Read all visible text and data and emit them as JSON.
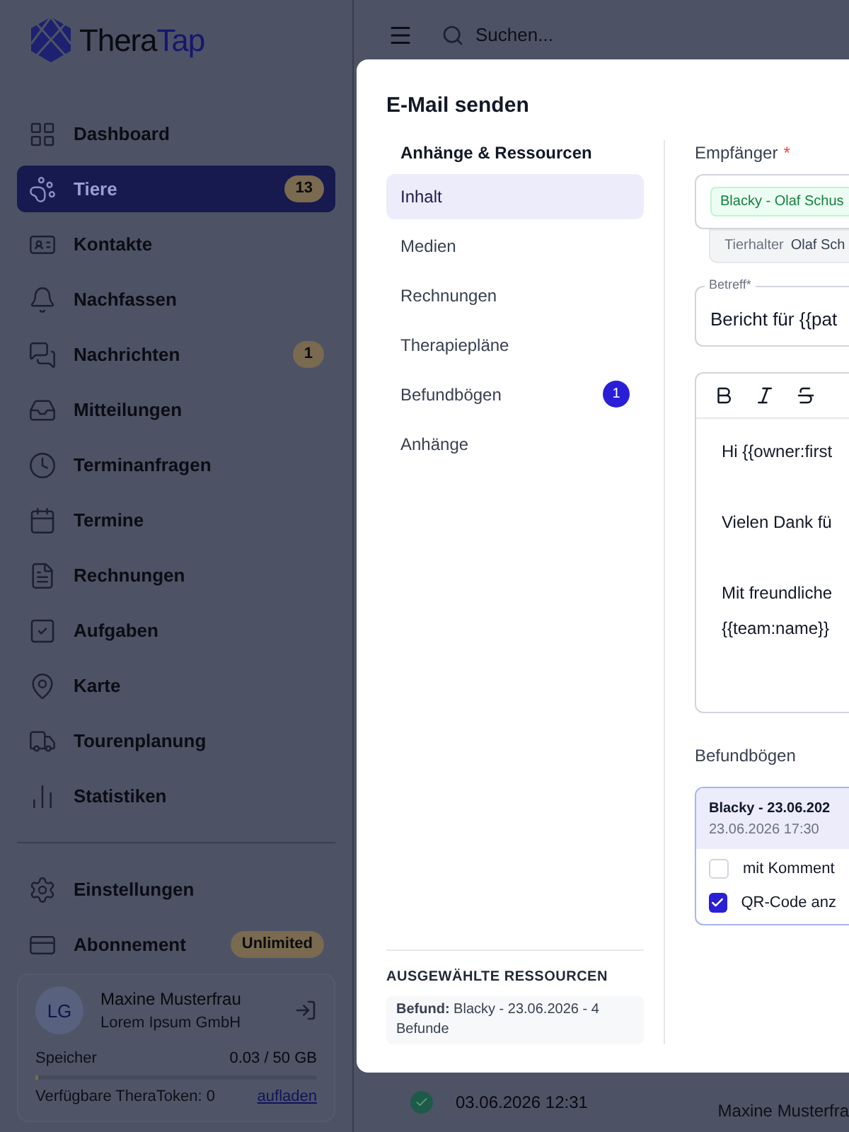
{
  "logo": {
    "primary": "Thera",
    "accent": "Tap"
  },
  "sidebar": {
    "items": [
      {
        "label": "Dashboard",
        "selected": false
      },
      {
        "label": "Tiere",
        "selected": true,
        "badge": "13"
      },
      {
        "label": "Kontakte",
        "selected": false
      },
      {
        "label": "Nachfassen",
        "selected": false
      },
      {
        "label": "Nachrichten",
        "selected": false,
        "badge": "1"
      },
      {
        "label": "Mitteilungen",
        "selected": false
      },
      {
        "label": "Terminanfragen",
        "selected": false
      },
      {
        "label": "Termine",
        "selected": false
      },
      {
        "label": "Rechnungen",
        "selected": false
      },
      {
        "label": "Aufgaben",
        "selected": false
      },
      {
        "label": "Karte",
        "selected": false
      },
      {
        "label": "Tourenplanung",
        "selected": false
      },
      {
        "label": "Statistiken",
        "selected": false
      }
    ],
    "bottom_items": [
      {
        "label": "Einstellungen",
        "selected": false
      },
      {
        "label": "Abonnement",
        "selected": false,
        "badge": "Unlimited"
      }
    ],
    "user": {
      "initials": "LG",
      "name": "Maxine Musterfrau",
      "company": "Lorem Ipsum GmbH",
      "storage_label": "Speicher",
      "storage_value": "0.03 / 50 GB",
      "level": 0.01,
      "tokens": "Verfügbare TheraToken: 0",
      "topup_link": "aufladen"
    }
  },
  "topbar": {
    "search": {
      "placeholder": "Suchen..."
    }
  },
  "background_row": {
    "date": "03.06.2026 12:31",
    "person": "Maxine Musterfra"
  },
  "dialog": {
    "title": "E-Mail senden",
    "resources": {
      "heading": "Anhänge & Ressourcen",
      "tabs": [
        {
          "label": "Inhalt",
          "selected": true
        },
        {
          "label": "Medien",
          "selected": false
        },
        {
          "label": "Rechnungen",
          "selected": false
        },
        {
          "label": "Therapiepläne",
          "selected": false
        },
        {
          "label": "Befundbögen",
          "selected": false,
          "badge": "1"
        },
        {
          "label": "Anhänge",
          "selected": false
        }
      ],
      "selected_heading": "AUSGEWÄHLTE RESSOURCEN",
      "selected_items": [
        {
          "label": "Befund:",
          "value": "Blacky - 23.06.2026 - 4 Befunde"
        }
      ]
    },
    "recipients": {
      "label": "Empfänger",
      "required_mark": "*",
      "chips": [
        "Blacky - Olaf Schus"
      ],
      "owner_label": "Tierhalter",
      "owner_value": "Olaf Sch"
    },
    "subject": {
      "label": "Betreff*",
      "value": "Bericht für {{pat"
    },
    "editor": {
      "paragraphs": [
        [
          "Hi {{owner:first"
        ],
        [
          "Vielen Dank fü"
        ],
        [
          "Mit freundliche",
          "{{team:name}}"
        ]
      ]
    },
    "forms": {
      "label": "Befundbögen",
      "card": {
        "title": "Blacky - 23.06.202",
        "date": "23.06.2026 17:30",
        "options": [
          {
            "label": "mit Komment",
            "checked": false
          },
          {
            "label": "QR-Code anz",
            "checked": true
          }
        ]
      }
    }
  }
}
